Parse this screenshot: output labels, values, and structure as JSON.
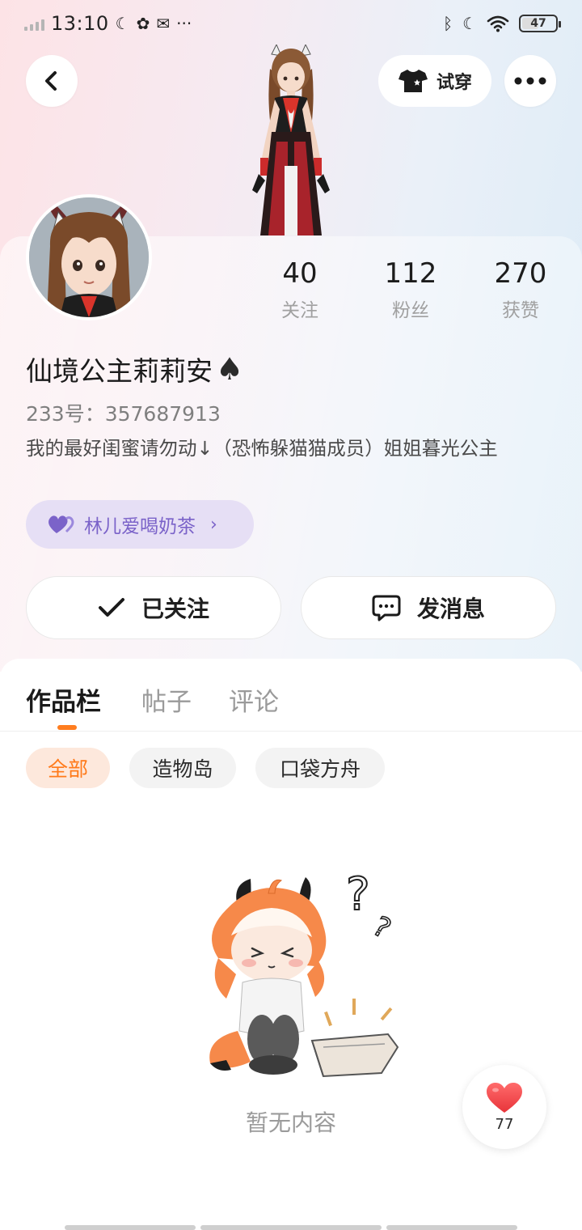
{
  "status_bar": {
    "time": "13:10",
    "battery": "47"
  },
  "top_bar": {
    "try_on_label": "试穿"
  },
  "profile": {
    "stats": [
      {
        "value": "40",
        "label": "关注"
      },
      {
        "value": "112",
        "label": "粉丝"
      },
      {
        "value": "270",
        "label": "获赞"
      }
    ],
    "username": "仙境公主莉莉安",
    "username_suffix": "♠",
    "user_id": "233号：357687913",
    "bio": "我的最好闺蜜请勿动↓（恐怖躲猫猫成员）姐姐暮光公主",
    "group_chip_label": "林儿爱喝奶茶",
    "follow_button_label": "已关注",
    "message_button_label": "发消息"
  },
  "tabs": [
    {
      "label": "作品栏",
      "active": true
    },
    {
      "label": "帖子",
      "active": false
    },
    {
      "label": "评论",
      "active": false
    }
  ],
  "filters": [
    {
      "label": "全部",
      "active": true
    },
    {
      "label": "造物岛",
      "active": false
    },
    {
      "label": "口袋方舟",
      "active": false
    }
  ],
  "empty_state": {
    "text": "暂无内容"
  },
  "like_fab": {
    "count": "77"
  },
  "colors": {
    "accent": "#ff7d1f",
    "group_chip_bg": "#e6dff5",
    "group_chip_text": "#7b63c9",
    "heart": "#f24a4a"
  }
}
